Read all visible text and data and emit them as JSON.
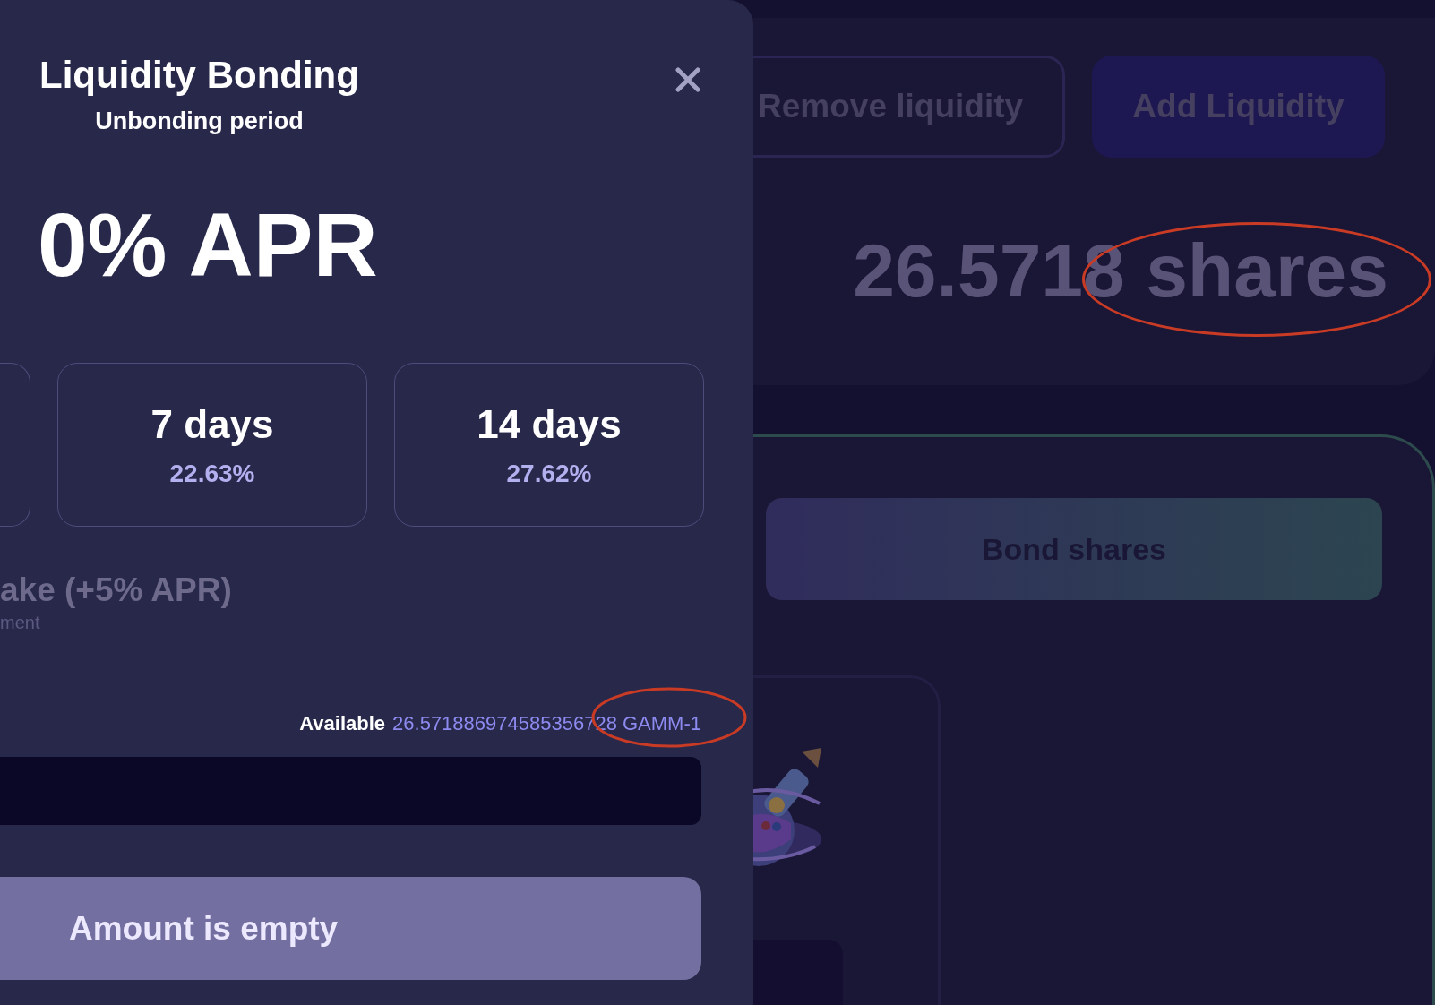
{
  "background": {
    "buttons": [
      {
        "label": "Remove liquidity",
        "kind": "outline"
      },
      {
        "label": "Add Liquidity",
        "kind": "filled"
      }
    ],
    "shares": "26.5718 shares",
    "bond_button": "Bond shares"
  },
  "modal": {
    "title": "Liquidity Bonding",
    "subtitle": "Unbonding period",
    "apr": "0% APR",
    "durations": [
      {
        "kind": "clipped"
      },
      {
        "kind": "full",
        "label": "7 days",
        "apr": "22.63%"
      },
      {
        "kind": "full",
        "label": "14 days",
        "apr": "27.62%"
      }
    ],
    "superfluid": {
      "title": "ake (+5% APR)",
      "subtitle": "ment"
    },
    "available": {
      "label": "Available",
      "amount": "26.571886974585356728 GAMM-1"
    },
    "submit_button": {
      "label": "Amount is empty",
      "disabled": true
    }
  }
}
